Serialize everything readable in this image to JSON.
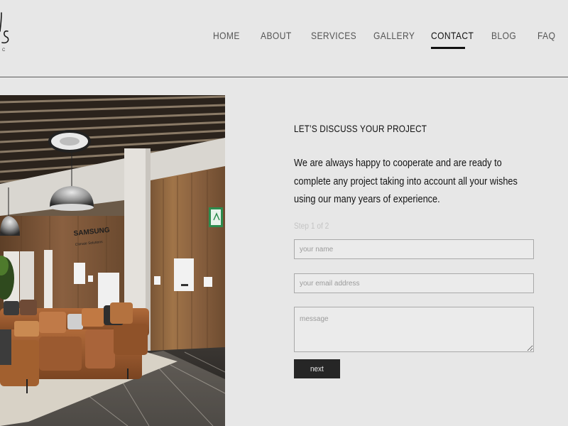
{
  "site": {
    "logo_tagline": "C"
  },
  "nav": {
    "items": [
      {
        "label": "HOME"
      },
      {
        "label": "ABOUT"
      },
      {
        "label": "SERVICES"
      },
      {
        "label": "GALLERY"
      },
      {
        "label": "CONTACT",
        "active": true
      },
      {
        "label": "BLOG"
      },
      {
        "label": "FAQ"
      }
    ]
  },
  "photo": {
    "wall_sign": "SAMSUNG",
    "wall_sign_sub": "Climate Solutions"
  },
  "contact": {
    "heading": "LET’S DISCUSS YOUR PROJECT",
    "intro": "We are always happy to cooperate and are ready to complete any project taking into account all your wishes using our many years of experience.",
    "step": "Step 1 of 2",
    "name_placeholder": "your name",
    "email_placeholder": "your email address",
    "message_placeholder": "message",
    "next_label": "next"
  },
  "colors": {
    "background": "#e7e7e7",
    "text": "#111111",
    "button": "#262626",
    "muted": "#c4c4c4"
  }
}
